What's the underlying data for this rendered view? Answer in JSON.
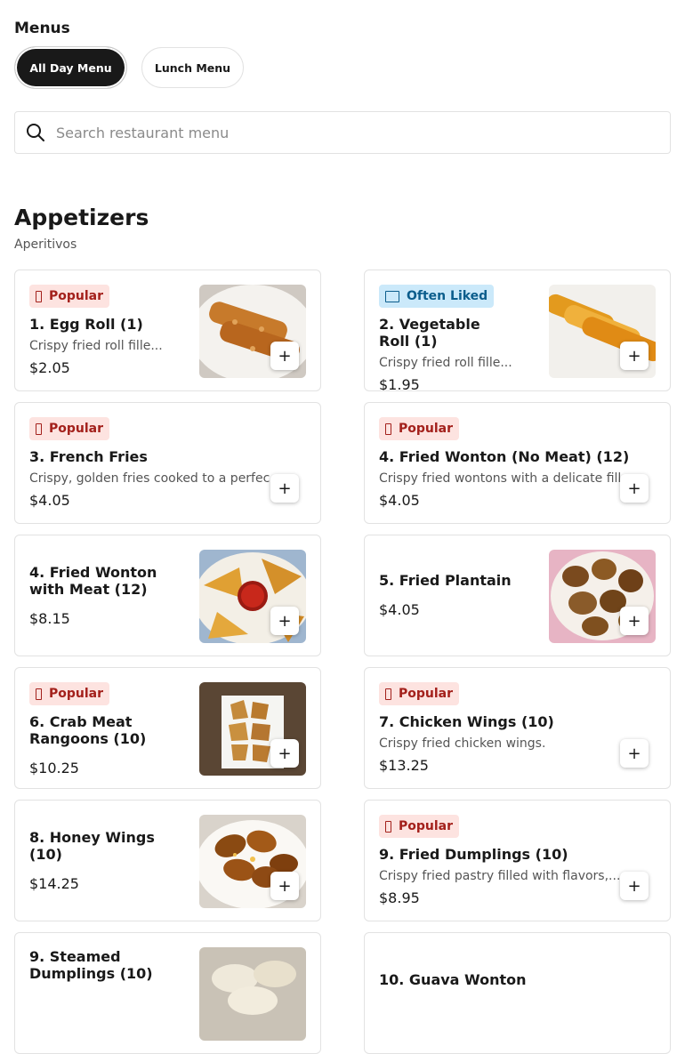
{
  "menus": {
    "title": "Menus",
    "tabs": [
      {
        "label": "All Day Menu",
        "active": true
      },
      {
        "label": "Lunch Menu",
        "active": false
      }
    ]
  },
  "search": {
    "placeholder": "Search restaurant menu",
    "value": ""
  },
  "section": {
    "title": "Appetizers",
    "subtitle": "Aperitivos"
  },
  "add_label": "+",
  "items": [
    {
      "badge": "Popular",
      "name": "1. Egg Roll (1)",
      "description": "Crispy fried roll fille...",
      "price": "$2.05",
      "image": "egg-roll-photo"
    },
    {
      "badge": "Often Liked",
      "name": "2. Vegetable Roll (1)",
      "description": "Crispy fried roll fille...",
      "price": "$1.95",
      "image": "vegetable-roll-photo"
    },
    {
      "badge": "Popular",
      "name": "3. French Fries",
      "description": "Crispy, golden fries cooked to a perfec",
      "price": "$4.05"
    },
    {
      "badge": "Popular",
      "name": "4. Fried Wonton (No Meat) (12)",
      "description": "Crispy fried wontons with a delicate fill",
      "price": "$4.05"
    },
    {
      "name": "4. Fried Wonton with Meat (12)",
      "price": "$8.15",
      "image": "fried-wonton-photo"
    },
    {
      "name": "5. Fried Plantain",
      "price": "$4.05",
      "image": "fried-plantain-photo"
    },
    {
      "badge": "Popular",
      "name": "6. Crab Meat Rangoons (10)",
      "price": "$10.25",
      "image": "crab-rangoon-photo"
    },
    {
      "badge": "Popular",
      "name": "7. Chicken Wings (10)",
      "description": "Crispy fried chicken wings.",
      "price": "$13.25"
    },
    {
      "name": "8. Honey Wings (10)",
      "price": "$14.25",
      "image": "honey-wings-photo"
    },
    {
      "badge": "Popular",
      "name": "9. Fried Dumplings (10)",
      "description": "Crispy fried pastry filled with flavors,...",
      "price": "$8.95"
    },
    {
      "name": "9. Steamed Dumplings (10)",
      "image": "steamed-dumplings-photo"
    },
    {
      "name": "10. Guava Wonton"
    }
  ],
  "colors": {
    "popular_bg": "#fde3e0",
    "popular_text": "#a3201b",
    "liked_bg": "#cbe9fa",
    "liked_text": "#0b5d8c",
    "active_tab": "#191919"
  }
}
